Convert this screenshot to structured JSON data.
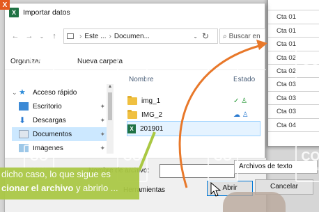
{
  "window": {
    "title": "Importar datos",
    "icon": "excel-icon"
  },
  "address": {
    "crumbs": [
      "Este ...",
      "Documen..."
    ],
    "search_placeholder": "Buscar en"
  },
  "toolbar": {
    "organize": "Organizar",
    "new_folder": "Nueva carpeta"
  },
  "nav": {
    "items": [
      {
        "label": "Acceso rápido",
        "icon": "star-icon"
      },
      {
        "label": "Escritorio",
        "icon": "desktop-icon"
      },
      {
        "label": "Descargas",
        "icon": "download-icon"
      },
      {
        "label": "Documentos",
        "icon": "documents-icon"
      },
      {
        "label": "Imágenes",
        "icon": "images-icon"
      }
    ]
  },
  "files": {
    "columns": {
      "name": "Nombre",
      "status": "Estado"
    },
    "rows": [
      {
        "name": "img_1",
        "type": "folder",
        "status": "✓ ♙"
      },
      {
        "name": "IMG_2",
        "type": "folder",
        "status": "☁ ♙"
      },
      {
        "name": "201901",
        "type": "excel",
        "status": ""
      }
    ]
  },
  "bottom": {
    "filename_label": "Nombre de archivo:",
    "filename_value": "",
    "filter": "Archivos de texto",
    "tools": "Herramientas",
    "open": "Abrir",
    "cancel": "Cancelar"
  },
  "sheet": {
    "cells": [
      "",
      "Cta 01",
      "Cta 01",
      "Cta 01",
      "Cta 02",
      "Cta 02",
      "Cta 03",
      "Cta 03",
      "Cta 03",
      "Cta 04"
    ]
  },
  "caption": {
    "prefix": "dicho caso, lo que sigue es",
    "line2_bold": "cionar el archivo",
    "line2_rest": " y abrirlo ..."
  },
  "watermark": {
    "brand": "CO",
    "sub": "COMPU"
  },
  "colors": {
    "accent": "#0078d7",
    "caption_bg": "#aac843",
    "arrow": "#e8782a",
    "excel": "#1f7244"
  }
}
